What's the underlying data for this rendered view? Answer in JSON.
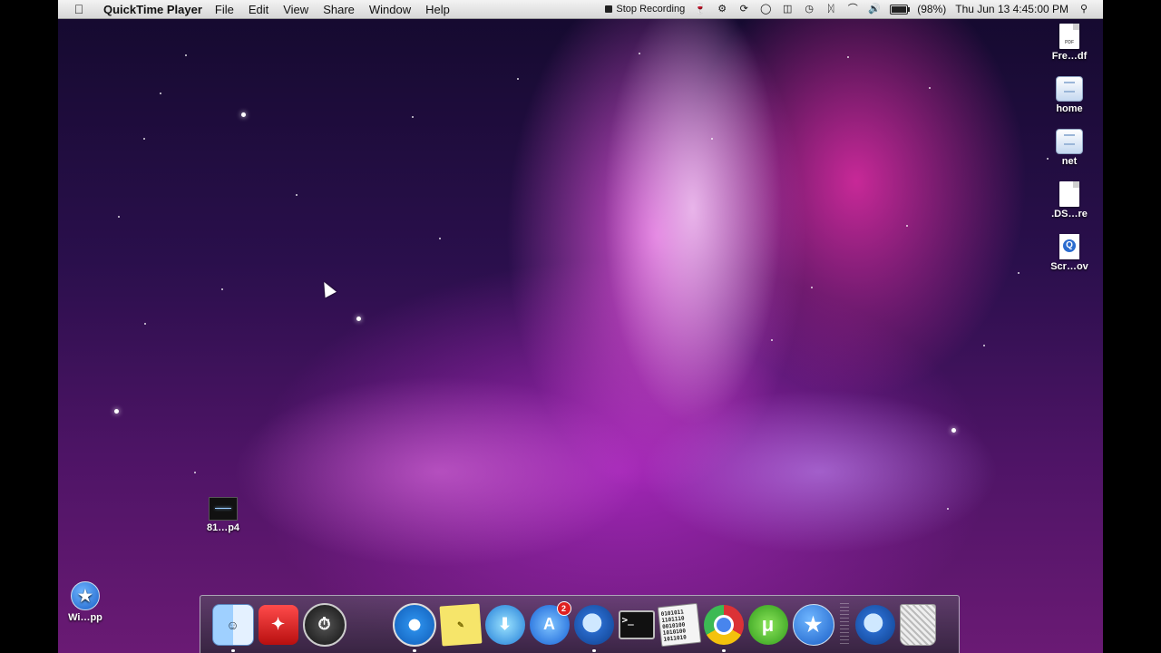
{
  "menubar": {
    "app_name": "QuickTime Player",
    "menus": [
      "File",
      "Edit",
      "View",
      "Share",
      "Window",
      "Help"
    ],
    "stop_recording": "Stop Recording",
    "battery_percent": "(98%)",
    "battery_level": 0.98,
    "clock": "Thu Jun 13  4:45:00 PM"
  },
  "desktop_icons": {
    "fre_pdf": "Fre…df",
    "home": "home",
    "net": "net",
    "ds_store": ".DS…re",
    "screen_mov": "Scr…ov",
    "video_mp4": "81…p4",
    "wi_app": "Wi…pp"
  },
  "dock": {
    "app_store_badge": "2",
    "terminal_prompt": ">_",
    "binary_text": "0101011 1101110 0010100 1010100 1011010"
  },
  "icons": [
    "apple-icon",
    "search-icon",
    "wifi-icon",
    "bluetooth-icon",
    "volume-icon",
    "battery-icon",
    "finder-icon",
    "safari-icon",
    "chrome-icon",
    "trash-icon"
  ]
}
